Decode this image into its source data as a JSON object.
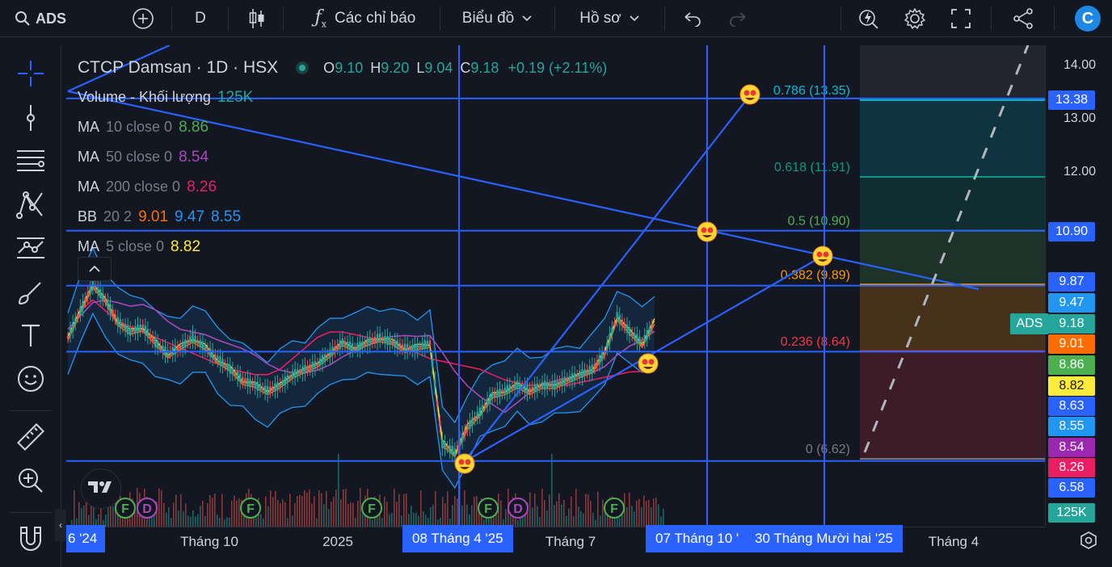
{
  "toolbar": {
    "symbol": "ADS",
    "interval": "D",
    "indicators_label": "Các chỉ báo",
    "chart_label": "Biểu đồ",
    "profile_label": "Hồ sơ",
    "logo_letter": "C"
  },
  "legend": {
    "title": "CTCP Damsan · 1D · HSX",
    "ohlc": {
      "o_label": "O",
      "o": "9.10",
      "h_label": "H",
      "h": "9.20",
      "l_label": "L",
      "l": "9.04",
      "c_label": "C",
      "c": "9.18",
      "change": "+0.19 (+2.11%)"
    },
    "volume": {
      "name": "Volume - Khối lượng",
      "value": "125K"
    },
    "ma10": {
      "name": "MA",
      "params": "10 close 0",
      "value": "8.86",
      "color": "#4caf50"
    },
    "ma50": {
      "name": "MA",
      "params": "50 close 0",
      "value": "8.54",
      "color": "#9c27b0"
    },
    "ma200": {
      "name": "MA",
      "params": "200 close 0",
      "value": "8.26",
      "color": "#e91e63"
    },
    "bb": {
      "name": "BB",
      "params": "20 2",
      "v1": "9.01",
      "v2": "9.47",
      "v3": "8.55",
      "c1": "#ff6d00",
      "c2": "#2196f3",
      "c3": "#2196f3"
    },
    "ma5": {
      "name": "MA",
      "params": "5 close 0",
      "value": "8.82",
      "color": "#ffeb3b"
    }
  },
  "chart_data": {
    "type": "candlestick",
    "symbol": "ADS",
    "timeframe": "1D",
    "price_range": [
      6.1,
      14.3
    ],
    "price_ticks": [
      "14.00",
      "13.00",
      "12.00"
    ],
    "x_ticks": [
      "6 '24",
      "Tháng 10",
      "2025",
      "08 Tháng 4 '25",
      "Tháng 7",
      "07 Tháng 10 '",
      "30 Tháng Mười hai '25",
      "Tháng 4"
    ],
    "fibonacci": [
      {
        "level": "0.786",
        "price": "13.35",
        "label": "0.786 (13.35)",
        "color": "#00bcd4"
      },
      {
        "level": "0.618",
        "price": "11.91",
        "label": "0.618 (11.91)",
        "color": "#089981"
      },
      {
        "level": "0.5",
        "price": "10.90",
        "label": "0.5 (10.90)",
        "color": "#4caf50"
      },
      {
        "level": "0.382",
        "price": "9.89",
        "label": "0.382 (9.89)",
        "color": "#ff9800"
      },
      {
        "level": "0.236",
        "price": "8.64",
        "label": "0.236 (8.64)",
        "color": "#f23645"
      },
      {
        "level": "0",
        "price": "6.62",
        "label": "0 (6.62)",
        "color": "#787b86"
      }
    ],
    "horizontal_lines": [
      13.38,
      10.9,
      9.87,
      8.63,
      6.58
    ],
    "price_labels": [
      {
        "value": "13.38",
        "bg": "#2962ff",
        "fg": "#ffffff"
      },
      {
        "value": "10.90",
        "bg": "#2962ff",
        "fg": "#ffffff"
      },
      {
        "value": "9.87",
        "bg": "#2962ff",
        "fg": "#ffffff"
      },
      {
        "value": "9.47",
        "bg": "#2196f3",
        "fg": "#ffffff"
      },
      {
        "value": "9.18",
        "bg": "#26a69a",
        "fg": "#ffffff"
      },
      {
        "value": "9.01",
        "bg": "#ff6d00",
        "fg": "#ffffff"
      },
      {
        "value": "8.86",
        "bg": "#4caf50",
        "fg": "#ffffff"
      },
      {
        "value": "8.82",
        "bg": "#ffeb3b",
        "fg": "#131722"
      },
      {
        "value": "8.63",
        "bg": "#2962ff",
        "fg": "#ffffff"
      },
      {
        "value": "8.55",
        "bg": "#2196f3",
        "fg": "#ffffff"
      },
      {
        "value": "8.54",
        "bg": "#9c27b0",
        "fg": "#ffffff"
      },
      {
        "value": "8.26",
        "bg": "#e91e63",
        "fg": "#ffffff"
      },
      {
        "value": "6.58",
        "bg": "#2962ff",
        "fg": "#ffffff"
      },
      {
        "value": "125K",
        "bg": "#26a69a",
        "fg": "#ffffff"
      }
    ],
    "current_price_tag": "ADS",
    "event_markers": [
      "F",
      "D",
      "F",
      "F",
      "F",
      "D",
      "F"
    ],
    "close_series": [
      8.9,
      9.4,
      9.9,
      9.6,
      9.2,
      9.0,
      9.1,
      8.8,
      8.6,
      8.7,
      8.9,
      8.7,
      8.5,
      8.3,
      8.1,
      8.0,
      7.9,
      8.0,
      8.2,
      8.3,
      8.4,
      8.6,
      8.8,
      8.7,
      8.8,
      8.9,
      8.8,
      8.7,
      8.7,
      8.8,
      6.9,
      6.75,
      7.2,
      7.5,
      7.8,
      7.9,
      8.0,
      7.9,
      8.0,
      8.0,
      8.1,
      8.2,
      8.3,
      8.6,
      9.3,
      9.0,
      8.8,
      9.18
    ],
    "colors": {
      "up": "#26a69a",
      "down": "#ef5350",
      "drawing": "#2962ff",
      "trend": "#2962ff"
    }
  }
}
